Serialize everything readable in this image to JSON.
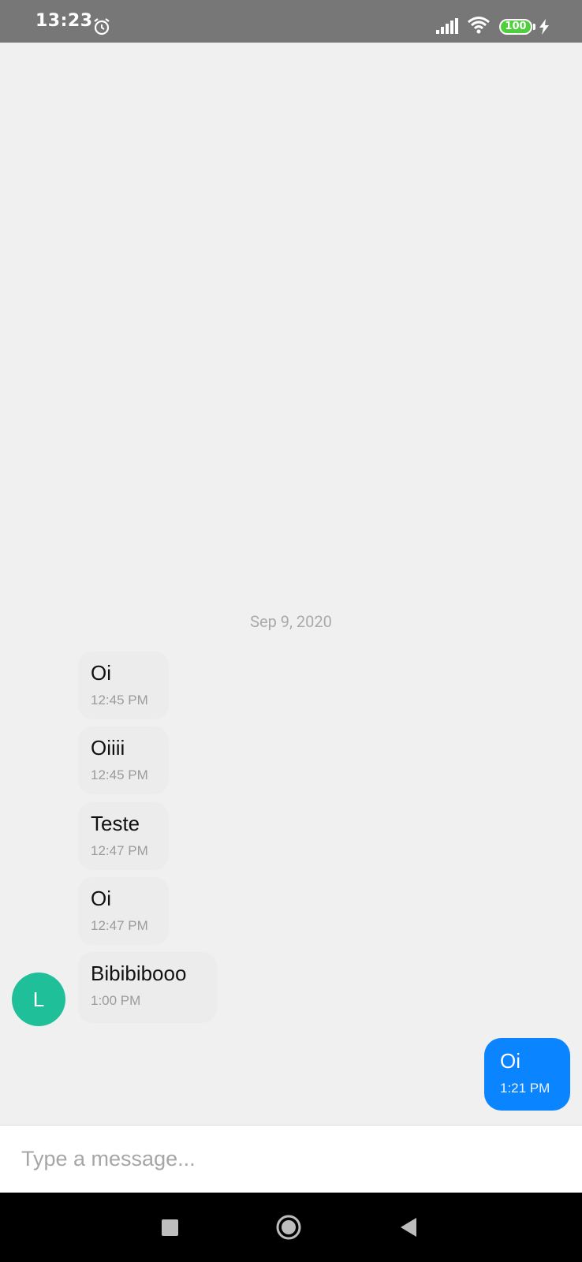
{
  "status_bar": {
    "time": "13:23",
    "battery_level": "100",
    "icons": [
      "alarm-icon",
      "signal-icon",
      "wifi-icon",
      "battery-icon",
      "charging-icon"
    ]
  },
  "conversation": {
    "date_separator": "Sep 9, 2020",
    "contact_initial": "L",
    "incoming": [
      {
        "text": "Oi",
        "time": "12:45 PM"
      },
      {
        "text": "Oiiii",
        "time": "12:45 PM"
      },
      {
        "text": "Teste",
        "time": "12:47 PM"
      },
      {
        "text": "Oi",
        "time": "12:47 PM"
      },
      {
        "text": "Bibibibooo",
        "time": "1:00 PM"
      }
    ],
    "outgoing": [
      {
        "text": "Oi",
        "time": "1:21 PM"
      }
    ]
  },
  "composer": {
    "placeholder": "Type a message...",
    "value": ""
  },
  "colors": {
    "outgoing_bubble": "#0a84ff",
    "avatar": "#1fbf9a",
    "status_bar": "#777777"
  },
  "nav_bar": {
    "icons": [
      "recents-icon",
      "home-icon",
      "back-icon"
    ]
  }
}
